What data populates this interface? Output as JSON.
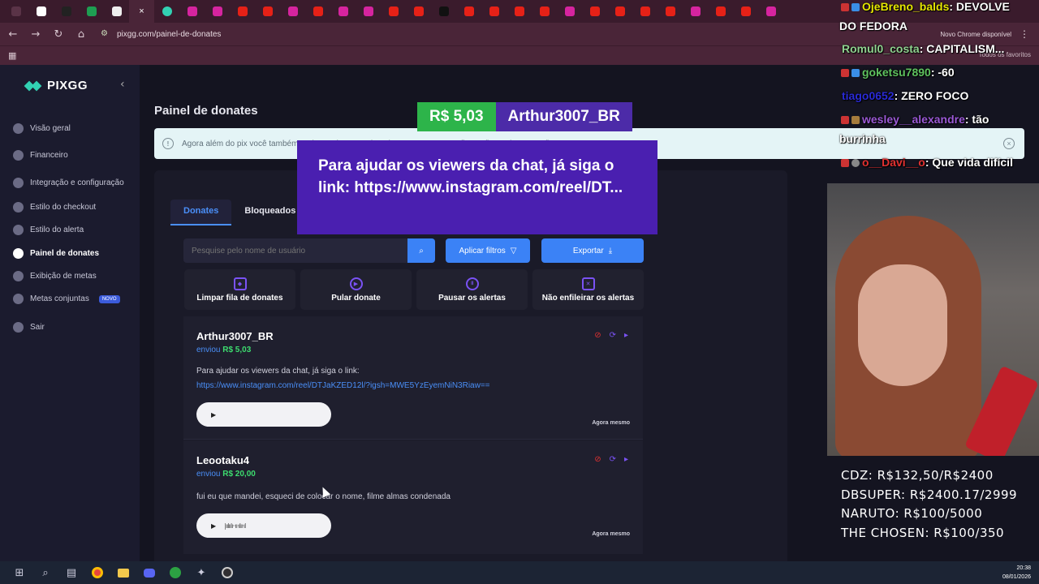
{
  "browser": {
    "url": "pixgg.com/painel-de-donates",
    "update_button": "Novo Chrome disponível",
    "favorites": "Todos os favoritos"
  },
  "sidebar": {
    "brand": "PIXGG",
    "items": [
      {
        "label": "Visão geral",
        "icon": "home-icon"
      },
      {
        "label": "Financeiro",
        "icon": "wallet-icon"
      },
      {
        "label": "Integração e configuração",
        "icon": "gear-icon"
      },
      {
        "label": "Estilo do checkout",
        "icon": "palette-icon"
      },
      {
        "label": "Estilo do alerta",
        "icon": "palette-icon"
      },
      {
        "label": "Painel de donates",
        "icon": "donate-icon"
      },
      {
        "label": "Exibição de metas",
        "icon": "star-icon"
      },
      {
        "label": "Metas conjuntas",
        "icon": "globe-icon",
        "badge": "NOVO"
      },
      {
        "label": "Sair",
        "icon": "logout-icon"
      }
    ]
  },
  "main": {
    "title": "Painel de donates",
    "info": "Agora além do pix você também pode receber em cripto, basta entrar em configuração e ativar a opção.",
    "tabs": [
      "Donates",
      "Bloqueados"
    ],
    "search_placeholder": "Pesquise pelo nome de usuário",
    "filter_button": "Aplicar filtros",
    "export_button": "Exportar",
    "actions": [
      "Limpar fila de donates",
      "Pular donate",
      "Pausar os alertas",
      "Não enfileirar os alertas"
    ],
    "donates": [
      {
        "name": "Arthur3007_BR",
        "sent_label": "enviou",
        "amount": "R$ 5,03",
        "message": "Para ajudar os viewers da chat, já siga o link:",
        "link": "https://www.instagram.com/reel/DTJaKZED12l/?igsh=MWE5YzEyemNiN3Riaw==",
        "time": "Agora mesmo"
      },
      {
        "name": "Leootaku4",
        "sent_label": "enviou",
        "amount": "R$ 20,00",
        "message": "fui eu que mandei, esqueci de colocar o nome, filme almas condenada",
        "link": "",
        "time": "Agora mesmo"
      }
    ]
  },
  "alert": {
    "amount": "R$ 5,03",
    "name": "Arthur3007_BR",
    "message": "Para ajudar os viewers da chat, já siga o link: https://www.instagram.com/reel/DT..."
  },
  "chat": [
    {
      "user": "OjeBreno_balds",
      "text": ": DEVOLVE"
    },
    {
      "user": "",
      "text": "DO FEDORA"
    },
    {
      "user": "Romul0_costa",
      "text": ": CAPITALISM..."
    },
    {
      "user": "goketsu7890",
      "text": ": -60"
    },
    {
      "user": "tiago0652",
      "text": ": ZERO FOCO"
    },
    {
      "user": "wesley__alexandre",
      "text": ": tão"
    },
    {
      "user": "",
      "text": "burrinha"
    },
    {
      "user": "o__Davi__o",
      "text": ": Que vida difícil"
    }
  ],
  "metas": [
    "CDZ: R$132,50/R$2400",
    "DBSUPER: R$2400.17/2999",
    "NARUTO: R$100/5000",
    "THE CHOSEN: R$100/350"
  ],
  "taskbar": {
    "time": "20:38",
    "date": "08/01/2026"
  }
}
